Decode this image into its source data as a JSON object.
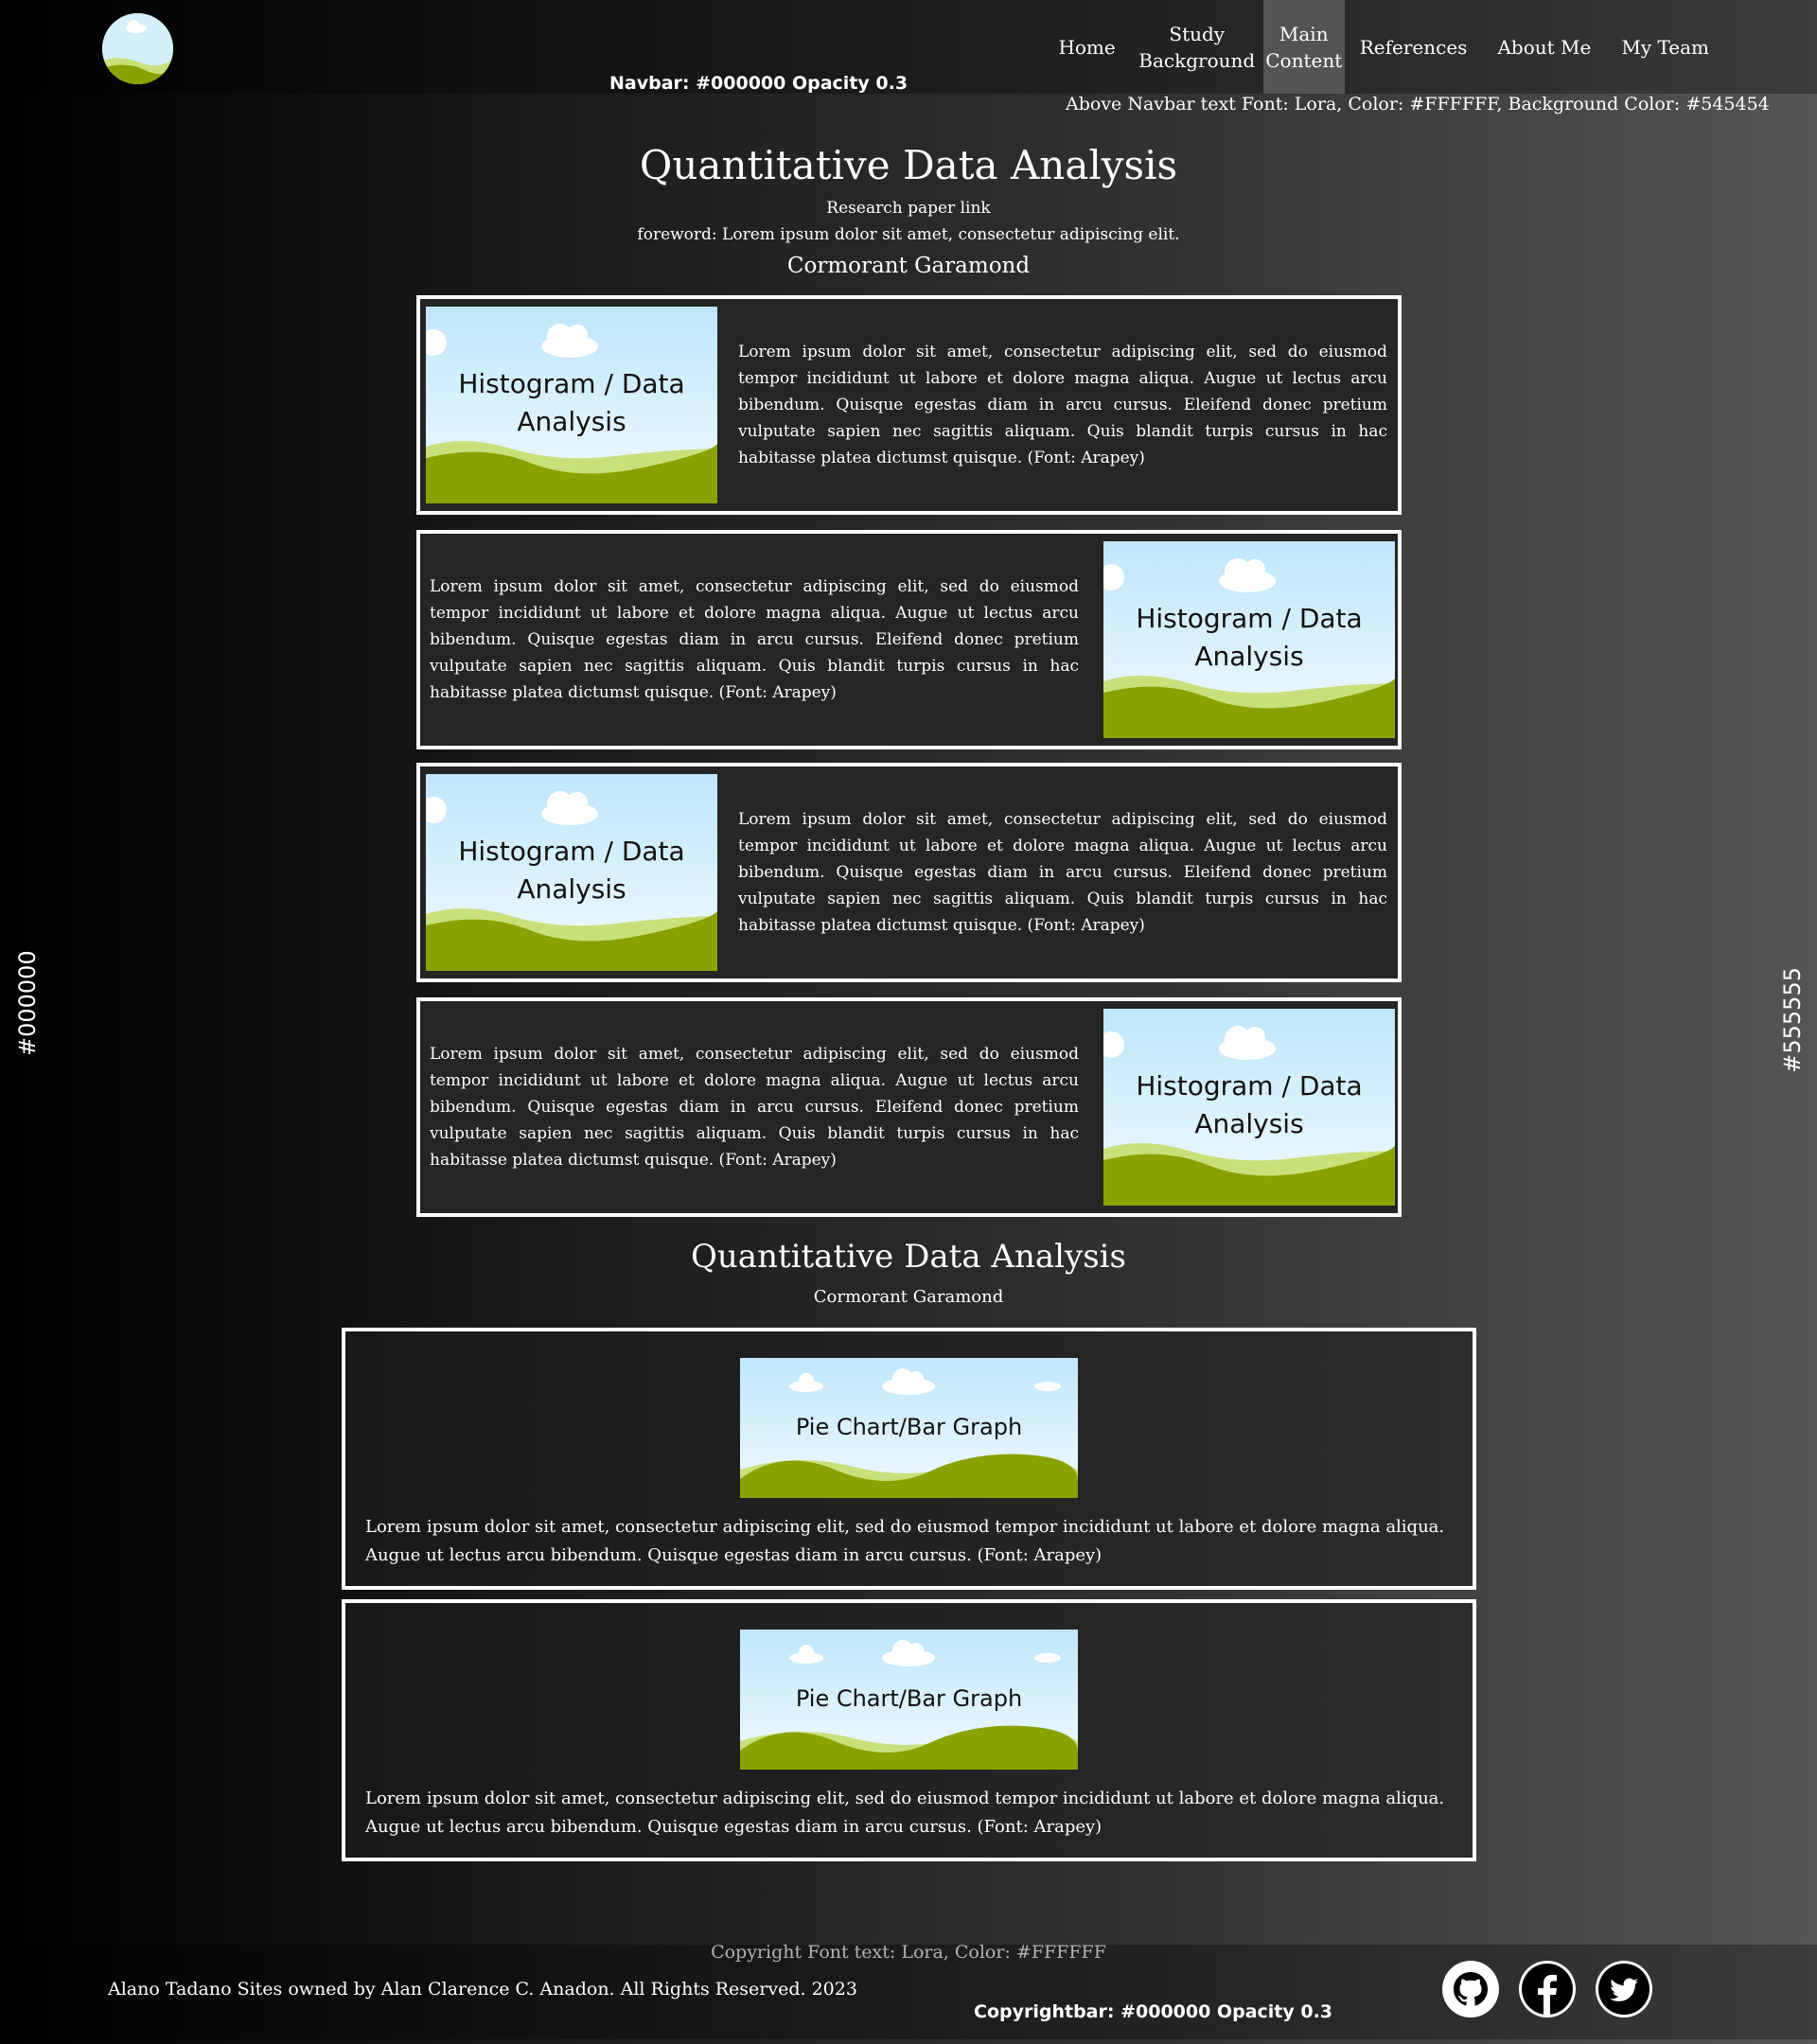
{
  "navbar": {
    "items": [
      "Home",
      "Study Background",
      "Main Content",
      "References",
      "About Me",
      "My Team"
    ],
    "active_item": "Main Content",
    "annotation": "Navbar: #000000 Opacity 0.3",
    "text_note": "Above Navbar text Font: Lora, Color: #FFFFFF, Background Color: #545454"
  },
  "side_labels": {
    "left": "#000000",
    "right": "#555555"
  },
  "section1": {
    "title": "Quantitative Data Analysis",
    "link": "Research paper link",
    "foreword": "foreword: Lorem ipsum dolor sit amet, consectetur adipiscing elit.",
    "font_note": "Cormorant Garamond"
  },
  "cards": [
    {
      "image_label": "Histogram / Data Analysis",
      "text": "Lorem ipsum dolor sit amet, consectetur adipiscing elit, sed do eiusmod tempor incididunt ut labore et dolore magna aliqua. Augue ut lectus arcu bibendum. Quisque egestas diam in arcu cursus. Eleifend donec pretium vulputate sapien nec sagittis aliquam. Quis blandit turpis cursus in hac habitasse platea dictumst quisque. (Font: Arapey)"
    },
    {
      "image_label": "Histogram / Data Analysis",
      "text": "Lorem ipsum dolor sit amet, consectetur adipiscing elit, sed do eiusmod tempor incididunt ut labore et dolore magna aliqua. Augue ut lectus arcu bibendum. Quisque egestas diam in arcu cursus. Eleifend donec pretium vulputate sapien nec sagittis aliquam. Quis blandit turpis cursus in hac habitasse platea dictumst quisque. (Font: Arapey)"
    },
    {
      "image_label": "Histogram / Data Analysis",
      "text": "Lorem ipsum dolor sit amet, consectetur adipiscing elit, sed do eiusmod tempor incididunt ut labore et dolore magna aliqua. Augue ut lectus arcu bibendum. Quisque egestas diam in arcu cursus. Eleifend donec pretium vulputate sapien nec sagittis aliquam. Quis blandit turpis cursus in hac habitasse platea dictumst quisque. (Font: Arapey)"
    },
    {
      "image_label": "Histogram / Data Analysis",
      "text": "Lorem ipsum dolor sit amet, consectetur adipiscing elit, sed do eiusmod tempor incididunt ut labore et dolore magna aliqua. Augue ut lectus arcu bibendum. Quisque egestas diam in arcu cursus. Eleifend donec pretium vulputate sapien nec sagittis aliquam. Quis blandit turpis cursus in hac habitasse platea dictumst quisque. (Font: Arapey)"
    }
  ],
  "section2": {
    "title": "Quantitative Data Analysis",
    "font_note": "Cormorant Garamond"
  },
  "wide_cards": [
    {
      "image_label": "Pie Chart/Bar Graph",
      "text": "Lorem ipsum dolor sit amet, consectetur adipiscing elit, sed do eiusmod tempor incididunt ut labore et dolore magna aliqua. Augue ut lectus arcu bibendum. Quisque egestas diam in arcu cursus. (Font: Arapey)"
    },
    {
      "image_label": "Pie Chart/Bar Graph",
      "text": "Lorem ipsum dolor sit amet, consectetur adipiscing elit, sed do eiusmod tempor incididunt ut labore et dolore magna aliqua. Augue ut lectus arcu bibendum. Quisque egestas diam in arcu cursus. (Font: Arapey)"
    }
  ],
  "footer": {
    "font_note": "Copyright Font text: Lora, Color: #FFFFFF",
    "copyright": "Alano Tadano Sites owned by Alan Clarence C. Anadon. All Rights Reserved. 2023",
    "annotation": "Copyrightbar: #000000 Opacity 0.3",
    "social_icons": [
      "github-icon",
      "facebook-icon",
      "twitter-icon"
    ]
  },
  "colors": {
    "navbar_active_bg": "#545454",
    "gradient_left": "#000000",
    "gradient_right": "#555555",
    "card_border": "#FFFFFF",
    "grass": "#8aa200",
    "hill_light": "#c8e07a",
    "sky": "#cfeefc"
  }
}
